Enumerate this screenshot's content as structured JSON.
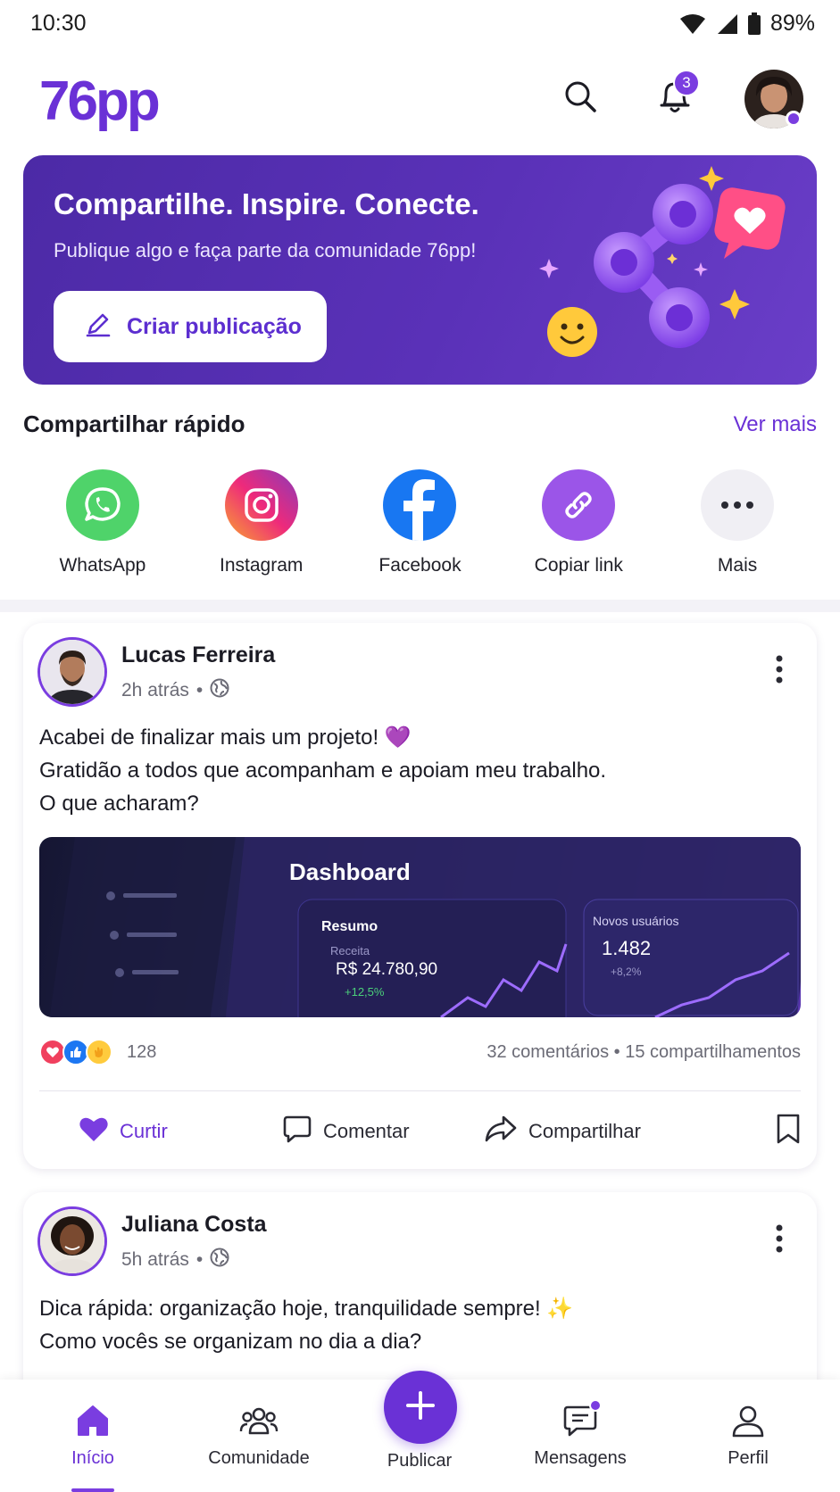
{
  "status_bar": {
    "time": "10:30",
    "battery": "89%"
  },
  "header": {
    "logo": "76pp",
    "notification_count": "3"
  },
  "banner": {
    "title": "Compartilhe. Inspire. Conecte.",
    "subtitle": "Publique algo e faça parte da comunidade 76pp!",
    "button_label": "Criar publicação"
  },
  "quick_share": {
    "title": "Compartilhar rápido",
    "more_label": "Ver mais",
    "items": [
      {
        "label": "WhatsApp",
        "icon": "whatsapp-icon",
        "color": "#4fd36a"
      },
      {
        "label": "Instagram",
        "icon": "instagram-icon",
        "color": "#e1306c"
      },
      {
        "label": "Facebook",
        "icon": "facebook-icon",
        "color": "#1877f2"
      },
      {
        "label": "Copiar link",
        "icon": "link-icon",
        "color": "#9b55e8"
      },
      {
        "label": "Mais",
        "icon": "more-icon",
        "color": "#f0eff4"
      }
    ]
  },
  "posts": [
    {
      "author": "Lucas Ferreira",
      "time": "2h atrás",
      "lines": [
        "Acabei de finalizar mais um projeto! 💜",
        "Gratidão a todos que acompanham e apoiam meu trabalho.",
        "O que acharam?"
      ],
      "image": {
        "title": "Dashboard",
        "summary_label": "Resumo",
        "revenue_label": "Receita",
        "revenue_value": "R$ 24.780,90",
        "revenue_change": "+12,5%",
        "users_label": "Novos usuários",
        "users_value": "1.482",
        "users_change": "+8,2%"
      },
      "reaction_count": "128",
      "stats": "32 comentários • 15 compartilhamentos",
      "actions": {
        "like": "Curtir",
        "comment": "Comentar",
        "share": "Compartilhar"
      }
    },
    {
      "author": "Juliana Costa",
      "time": "5h atrás",
      "lines": [
        "Dica rápida: organização hoje, tranquilidade sempre! ✨",
        "Como vocês se organizam no dia a dia?"
      ]
    }
  ],
  "bottom_nav": {
    "items": [
      "Início",
      "Comunidade",
      "Publicar",
      "Mensagens",
      "Perfil"
    ],
    "active": "Início"
  },
  "colors": {
    "accent": "#6a31d6",
    "banner": "#5a31b8"
  }
}
